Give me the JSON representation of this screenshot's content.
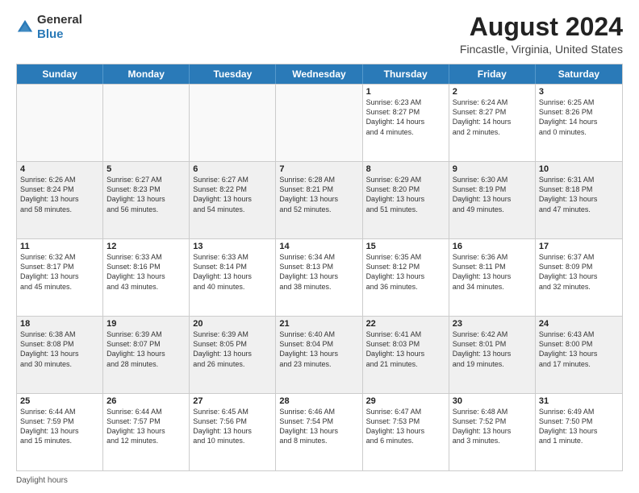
{
  "header": {
    "logo_general": "General",
    "logo_blue": "Blue",
    "month_year": "August 2024",
    "location": "Fincastle, Virginia, United States"
  },
  "days_of_week": [
    "Sunday",
    "Monday",
    "Tuesday",
    "Wednesday",
    "Thursday",
    "Friday",
    "Saturday"
  ],
  "footer": "Daylight hours",
  "weeks": [
    [
      {
        "day": "",
        "text": "",
        "empty": true
      },
      {
        "day": "",
        "text": "",
        "empty": true
      },
      {
        "day": "",
        "text": "",
        "empty": true
      },
      {
        "day": "",
        "text": "",
        "empty": true
      },
      {
        "day": "1",
        "text": "Sunrise: 6:23 AM\nSunset: 8:27 PM\nDaylight: 14 hours\nand 4 minutes."
      },
      {
        "day": "2",
        "text": "Sunrise: 6:24 AM\nSunset: 8:27 PM\nDaylight: 14 hours\nand 2 minutes."
      },
      {
        "day": "3",
        "text": "Sunrise: 6:25 AM\nSunset: 8:26 PM\nDaylight: 14 hours\nand 0 minutes."
      }
    ],
    [
      {
        "day": "4",
        "text": "Sunrise: 6:26 AM\nSunset: 8:24 PM\nDaylight: 13 hours\nand 58 minutes."
      },
      {
        "day": "5",
        "text": "Sunrise: 6:27 AM\nSunset: 8:23 PM\nDaylight: 13 hours\nand 56 minutes."
      },
      {
        "day": "6",
        "text": "Sunrise: 6:27 AM\nSunset: 8:22 PM\nDaylight: 13 hours\nand 54 minutes."
      },
      {
        "day": "7",
        "text": "Sunrise: 6:28 AM\nSunset: 8:21 PM\nDaylight: 13 hours\nand 52 minutes."
      },
      {
        "day": "8",
        "text": "Sunrise: 6:29 AM\nSunset: 8:20 PM\nDaylight: 13 hours\nand 51 minutes."
      },
      {
        "day": "9",
        "text": "Sunrise: 6:30 AM\nSunset: 8:19 PM\nDaylight: 13 hours\nand 49 minutes."
      },
      {
        "day": "10",
        "text": "Sunrise: 6:31 AM\nSunset: 8:18 PM\nDaylight: 13 hours\nand 47 minutes."
      }
    ],
    [
      {
        "day": "11",
        "text": "Sunrise: 6:32 AM\nSunset: 8:17 PM\nDaylight: 13 hours\nand 45 minutes."
      },
      {
        "day": "12",
        "text": "Sunrise: 6:33 AM\nSunset: 8:16 PM\nDaylight: 13 hours\nand 43 minutes."
      },
      {
        "day": "13",
        "text": "Sunrise: 6:33 AM\nSunset: 8:14 PM\nDaylight: 13 hours\nand 40 minutes."
      },
      {
        "day": "14",
        "text": "Sunrise: 6:34 AM\nSunset: 8:13 PM\nDaylight: 13 hours\nand 38 minutes."
      },
      {
        "day": "15",
        "text": "Sunrise: 6:35 AM\nSunset: 8:12 PM\nDaylight: 13 hours\nand 36 minutes."
      },
      {
        "day": "16",
        "text": "Sunrise: 6:36 AM\nSunset: 8:11 PM\nDaylight: 13 hours\nand 34 minutes."
      },
      {
        "day": "17",
        "text": "Sunrise: 6:37 AM\nSunset: 8:09 PM\nDaylight: 13 hours\nand 32 minutes."
      }
    ],
    [
      {
        "day": "18",
        "text": "Sunrise: 6:38 AM\nSunset: 8:08 PM\nDaylight: 13 hours\nand 30 minutes."
      },
      {
        "day": "19",
        "text": "Sunrise: 6:39 AM\nSunset: 8:07 PM\nDaylight: 13 hours\nand 28 minutes."
      },
      {
        "day": "20",
        "text": "Sunrise: 6:39 AM\nSunset: 8:05 PM\nDaylight: 13 hours\nand 26 minutes."
      },
      {
        "day": "21",
        "text": "Sunrise: 6:40 AM\nSunset: 8:04 PM\nDaylight: 13 hours\nand 23 minutes."
      },
      {
        "day": "22",
        "text": "Sunrise: 6:41 AM\nSunset: 8:03 PM\nDaylight: 13 hours\nand 21 minutes."
      },
      {
        "day": "23",
        "text": "Sunrise: 6:42 AM\nSunset: 8:01 PM\nDaylight: 13 hours\nand 19 minutes."
      },
      {
        "day": "24",
        "text": "Sunrise: 6:43 AM\nSunset: 8:00 PM\nDaylight: 13 hours\nand 17 minutes."
      }
    ],
    [
      {
        "day": "25",
        "text": "Sunrise: 6:44 AM\nSunset: 7:59 PM\nDaylight: 13 hours\nand 15 minutes."
      },
      {
        "day": "26",
        "text": "Sunrise: 6:44 AM\nSunset: 7:57 PM\nDaylight: 13 hours\nand 12 minutes."
      },
      {
        "day": "27",
        "text": "Sunrise: 6:45 AM\nSunset: 7:56 PM\nDaylight: 13 hours\nand 10 minutes."
      },
      {
        "day": "28",
        "text": "Sunrise: 6:46 AM\nSunset: 7:54 PM\nDaylight: 13 hours\nand 8 minutes."
      },
      {
        "day": "29",
        "text": "Sunrise: 6:47 AM\nSunset: 7:53 PM\nDaylight: 13 hours\nand 6 minutes."
      },
      {
        "day": "30",
        "text": "Sunrise: 6:48 AM\nSunset: 7:52 PM\nDaylight: 13 hours\nand 3 minutes."
      },
      {
        "day": "31",
        "text": "Sunrise: 6:49 AM\nSunset: 7:50 PM\nDaylight: 13 hours\nand 1 minute."
      }
    ]
  ]
}
